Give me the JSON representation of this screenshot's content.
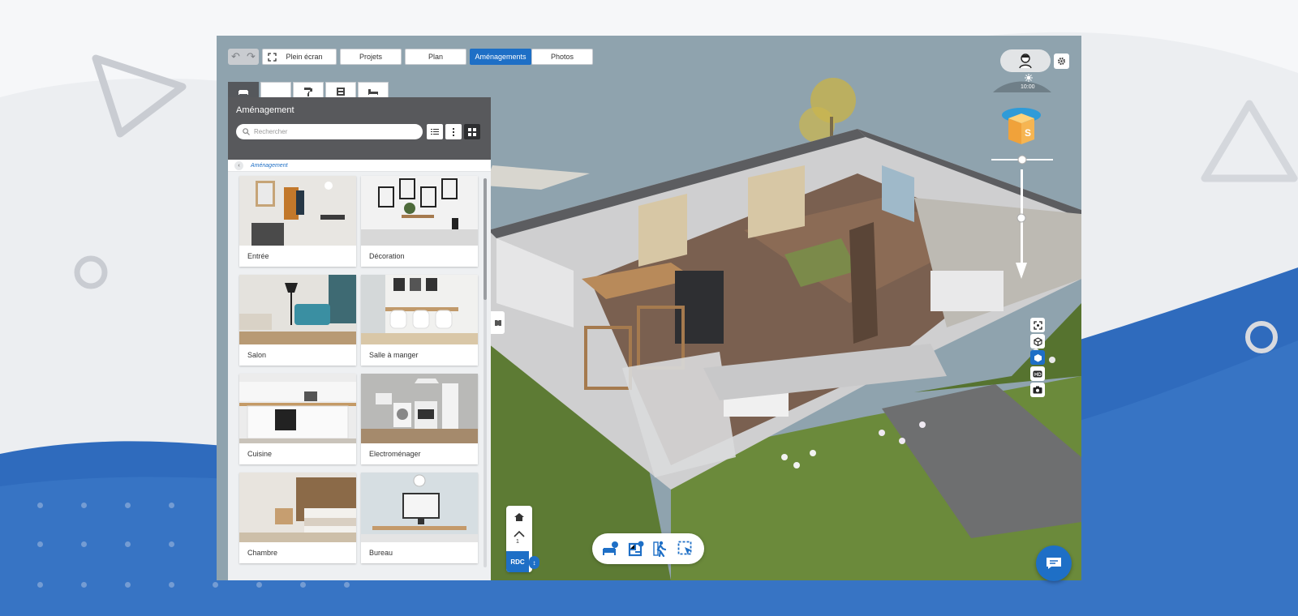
{
  "toolbar": {
    "undo_icon": "undo-icon",
    "redo_icon": "redo-icon",
    "fullscreen_label": "Plein écran",
    "tabs": [
      {
        "label": "Projets",
        "active": false
      },
      {
        "label": "Plan",
        "active": false
      },
      {
        "label": "Aménagements",
        "active": true
      },
      {
        "label": "Photos",
        "active": false
      }
    ]
  },
  "panel": {
    "tab_icons": [
      "sofa-icon",
      "blank-tab",
      "paint-roller-icon",
      "cabinet-icon",
      "bed-icon"
    ],
    "title": "Aménagement",
    "search_placeholder": "Rechercher",
    "breadcrumb": "Aménagement",
    "categories": [
      {
        "label": "Entrée"
      },
      {
        "label": "Décoration"
      },
      {
        "label": "Salon"
      },
      {
        "label": "Salle à manger"
      },
      {
        "label": "Cuisine"
      },
      {
        "label": "Electroménager"
      },
      {
        "label": "Chambre"
      },
      {
        "label": "Bureau"
      }
    ]
  },
  "view": {
    "time": "10:00",
    "floor_1": "1",
    "floor_current": "RDC"
  },
  "colors": {
    "accent": "#1e6fc6",
    "panel_header": "#58595c",
    "sky": "#8fa3ae",
    "grass": "#5d7b34"
  }
}
